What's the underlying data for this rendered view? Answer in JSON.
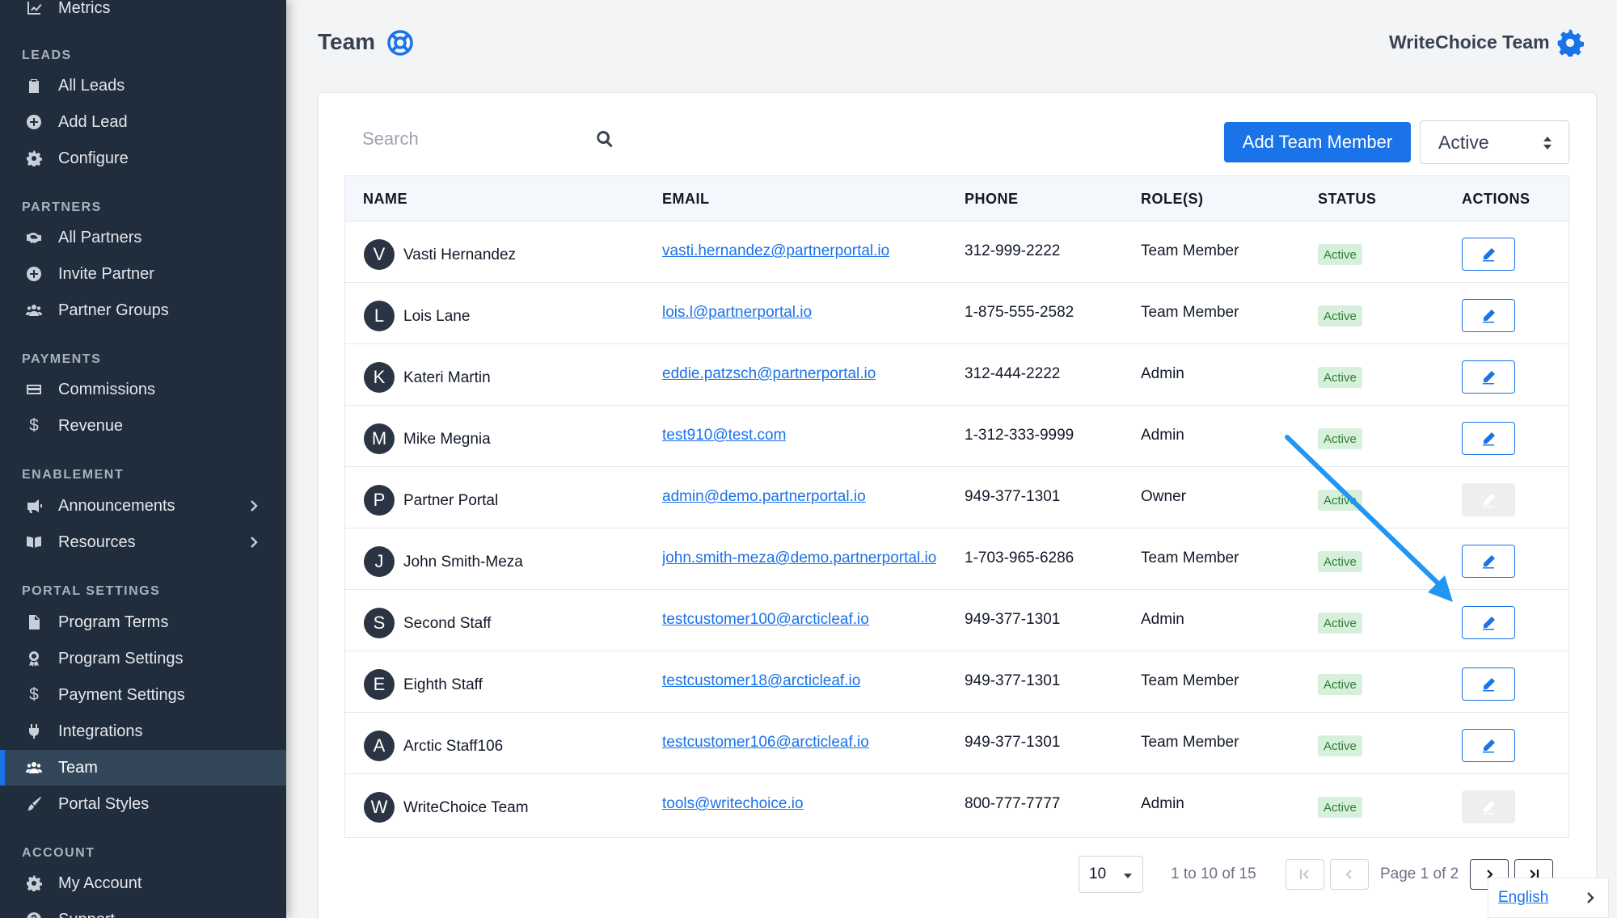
{
  "sidebar": {
    "top_item": "Metrics",
    "sections": {
      "leads": "LEADS",
      "partners": "PARTNERS",
      "payments": "PAYMENTS",
      "enablement": "ENABLEMENT",
      "portal_settings": "PORTAL SETTINGS",
      "account": "ACCOUNT"
    },
    "items": {
      "all_leads": "All Leads",
      "add_lead": "Add Lead",
      "configure": "Configure",
      "all_partners": "All Partners",
      "invite_partner": "Invite Partner",
      "partner_groups": "Partner Groups",
      "commissions": "Commissions",
      "revenue": "Revenue",
      "announcements": "Announcements",
      "resources": "Resources",
      "program_terms": "Program Terms",
      "program_settings": "Program Settings",
      "payment_settings": "Payment Settings",
      "integrations": "Integrations",
      "team": "Team",
      "portal_styles": "Portal Styles",
      "my_account": "My Account",
      "support": "Support"
    }
  },
  "header": {
    "title": "Team",
    "org_name": "WriteChoice Team"
  },
  "toolbar": {
    "search_placeholder": "Search",
    "add_button": "Add Team Member",
    "status_filter": "Active"
  },
  "table": {
    "headers": {
      "name": "NAME",
      "email": "EMAIL",
      "phone": "PHONE",
      "roles": "ROLE(S)",
      "status": "STATUS",
      "actions": "ACTIONS"
    },
    "rows": [
      {
        "initial": "V",
        "name": "Vasti Hernandez",
        "email": "vasti.hernandez@partnerportal.io",
        "phone": "312-999-2222",
        "role": "Team Member",
        "status": "Active",
        "editable": true
      },
      {
        "initial": "L",
        "name": "Lois Lane",
        "email": "lois.l@partnerportal.io",
        "phone": "1-875-555-2582",
        "role": "Team Member",
        "status": "Active",
        "editable": true
      },
      {
        "initial": "K",
        "name": "Kateri Martin",
        "email": "eddie.patzsch@partnerportal.io",
        "phone": "312-444-2222",
        "role": "Admin",
        "status": "Active",
        "editable": true
      },
      {
        "initial": "M",
        "name": "Mike Megnia",
        "email": "test910@test.com",
        "phone": "1-312-333-9999",
        "role": "Admin",
        "status": "Active",
        "editable": true
      },
      {
        "initial": "P",
        "name": "Partner Portal",
        "email": "admin@demo.partnerportal.io",
        "phone": "949-377-1301",
        "role": "Owner",
        "status": "Active",
        "editable": false
      },
      {
        "initial": "J",
        "name": "John Smith-Meza",
        "email": "john.smith-meza@demo.partnerportal.io",
        "phone": "1-703-965-6286",
        "role": "Team Member",
        "status": "Active",
        "editable": true
      },
      {
        "initial": "S",
        "name": "Second Staff",
        "email": "testcustomer100@arcticleaf.io",
        "phone": "949-377-1301",
        "role": "Admin",
        "status": "Active",
        "editable": true
      },
      {
        "initial": "E",
        "name": "Eighth Staff",
        "email": "testcustomer18@arcticleaf.io",
        "phone": "949-377-1301",
        "role": "Team Member",
        "status": "Active",
        "editable": true
      },
      {
        "initial": "A",
        "name": "Arctic Staff106",
        "email": "testcustomer106@arcticleaf.io",
        "phone": "949-377-1301",
        "role": "Team Member",
        "status": "Active",
        "editable": true
      },
      {
        "initial": "W",
        "name": "WriteChoice Team",
        "email": "tools@writechoice.io",
        "phone": "800-777-7777",
        "role": "Admin",
        "status": "Active",
        "editable": false
      }
    ]
  },
  "pagination": {
    "per_page": "10",
    "range": "1 to 10 of 15",
    "page": "Page 1 of 2"
  },
  "language": "English",
  "colors": {
    "accent": "#1a73e8",
    "sidebar_bg": "#1f2d3d",
    "badge_bg": "#d7f0dc",
    "badge_text": "#2e7d32",
    "annotation_arrow": "#2196f3"
  }
}
